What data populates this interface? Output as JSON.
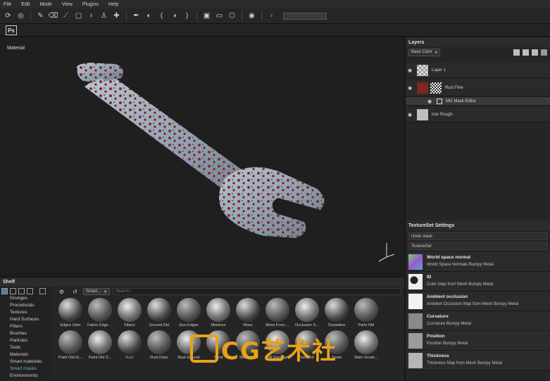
{
  "menu": [
    "File",
    "Edit",
    "Mode",
    "View",
    "Plugins",
    "Help"
  ],
  "viewport": {
    "label": "Material"
  },
  "layers": {
    "title": "Layers",
    "channel_select": "Base Color",
    "items": [
      {
        "name": "Layer 1"
      },
      {
        "name": "Rust Fine"
      },
      {
        "name": "MG Mask Editor"
      },
      {
        "name": "Iron Rough"
      }
    ]
  },
  "textureset": {
    "title": "TextureSet Settings",
    "undo": "Undo stack",
    "set": "TextureSet",
    "channels": [
      {
        "title": "World space normal",
        "sub": "World Space Normals Bumpy Metal"
      },
      {
        "title": "ID",
        "sub": "Color Map from Mesh Bumpy Metal"
      },
      {
        "title": "Ambient occlusion",
        "sub": "Ambient Occlusion Map from Mesh Bumpy Metal"
      },
      {
        "title": "Curvature",
        "sub": "Curvature Bumpy Metal"
      },
      {
        "title": "Position",
        "sub": "Position Bumpy Metal"
      },
      {
        "title": "Thickness",
        "sub": "Thickness Map from Mesh Bumpy Metal"
      }
    ]
  },
  "shelf": {
    "title": "Shelf",
    "categories": [
      "Grunges",
      "Procedurals",
      "Textures",
      "Hard Surfaces",
      "Filters",
      "Brushes",
      "Particles",
      "Tools",
      "Materials",
      "Smart materials",
      "Smart masks",
      "Environments"
    ],
    "active_category": "Smart masks",
    "filter_chip": "Smart...",
    "search_placeholder": "Search...",
    "row1": [
      "Edges Uber",
      "Fabric Edge ...",
      "Fibers",
      "Ground Dirt",
      "Gun Edges",
      "Moisture",
      "Moss",
      "Moss From ...",
      "Occlusion S...",
      "Oxydation",
      "Paint Old"
    ],
    "row2": [
      "Paint Old Di...",
      "Paint Old S...",
      "Rust",
      "Rust Drips",
      "Rust Ground",
      "Sand",
      "Sharp Dirt",
      "Soft Damages",
      "Soft Dirt",
      "Spots",
      "Stain Scratc..."
    ],
    "selected": "Rust"
  },
  "watermark": {
    "text": "CG艺术社"
  },
  "colors": {
    "accent": "#5cb6e8",
    "rust": "#8a2a1a",
    "metal": "#8fa3b8"
  }
}
